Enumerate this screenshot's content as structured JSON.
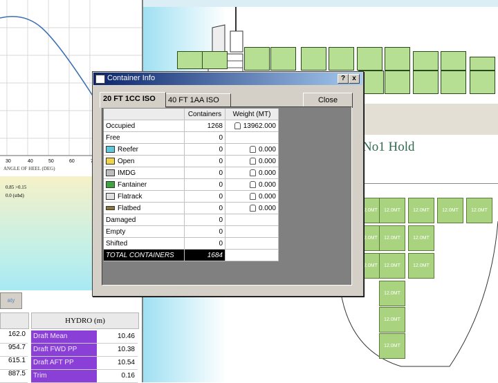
{
  "background": {
    "chart": {
      "x_ticks": [
        "30",
        "40",
        "50",
        "60",
        "7"
      ],
      "x_label": "ANGLE OF HEEL (DEG)"
    },
    "heel_info": {
      "line1": "0.85  >0.15",
      "line2": "0.0  (stbd)"
    },
    "tab_label": "aty",
    "hold_title": "No1 Hold",
    "container_weight_label": "12.0MT",
    "left_values": [
      "162.0",
      "954.7",
      "615.1",
      "887.5"
    ],
    "hydro": {
      "header": "HYDRO (m)",
      "rows": [
        {
          "label": "Draft Mean",
          "value": "10.46"
        },
        {
          "label": "Draft FWD PP",
          "value": "10.38"
        },
        {
          "label": "Draft AFT PP",
          "value": "10.54"
        },
        {
          "label": "Trim",
          "value": "0.16"
        }
      ]
    }
  },
  "dialog": {
    "title": "Container Info",
    "help_btn": "?",
    "close_x": "x",
    "tabs": [
      "20 FT 1CC ISO",
      "40 FT 1AA ISO"
    ],
    "close_button": "Close",
    "columns": [
      "",
      "Containers",
      "Weight (MT)"
    ],
    "rows": [
      {
        "label": "Occupied",
        "icon": "",
        "containers": "1268",
        "lock": true,
        "weight": "13962.000"
      },
      {
        "label": "Free",
        "icon": "",
        "containers": "0",
        "lock": false,
        "weight": ""
      },
      {
        "label": "Reefer",
        "icon": "reefer-icon",
        "containers": "0",
        "lock": true,
        "weight": "0.000"
      },
      {
        "label": "Open",
        "icon": "open-top-icon",
        "containers": "0",
        "lock": true,
        "weight": "0.000"
      },
      {
        "label": "IMDG",
        "icon": "imdg-icon",
        "containers": "0",
        "lock": true,
        "weight": "0.000"
      },
      {
        "label": "Fantainer",
        "icon": "fantainer-icon",
        "containers": "0",
        "lock": true,
        "weight": "0.000"
      },
      {
        "label": "Flatrack",
        "icon": "flatrack-icon",
        "containers": "0",
        "lock": true,
        "weight": "0.000"
      },
      {
        "label": "Flatbed",
        "icon": "flatbed-icon",
        "containers": "0",
        "lock": true,
        "weight": "0.000"
      },
      {
        "label": "Damaged",
        "icon": "",
        "containers": "0",
        "lock": false,
        "weight": ""
      },
      {
        "label": "Empty",
        "icon": "",
        "containers": "0",
        "lock": false,
        "weight": ""
      },
      {
        "label": "Shifted",
        "icon": "",
        "containers": "0",
        "lock": false,
        "weight": ""
      }
    ],
    "total": {
      "label": "TOTAL CONTAINERS",
      "value": "1684"
    }
  },
  "colors": {
    "title_bar": "#0a246a",
    "container_green": "#b6df94",
    "hydro_label": "#8a3fd6"
  }
}
